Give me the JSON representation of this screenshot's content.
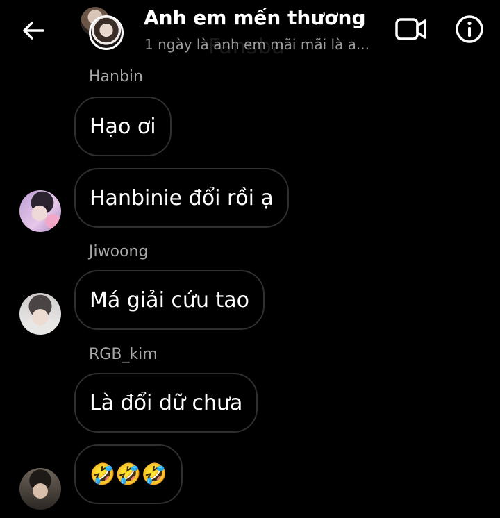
{
  "header": {
    "title": "Anh em mến thương",
    "subtitle": "1 ngày là anh em mãi mãi là a...",
    "watermark": "Fansba",
    "icons": {
      "back": "arrow-left-icon",
      "video": "video-camera-icon",
      "info": "info-icon"
    }
  },
  "messages": [
    {
      "sender": "Hanbin",
      "text": "Hạo ơi"
    },
    {
      "sender": "",
      "text": "Hanbinie đổi rồi ạ"
    },
    {
      "sender": "Jiwoong",
      "text": "Má giải cứu tao"
    },
    {
      "sender": "RGB_kim",
      "text": "Là đổi dữ chưa"
    },
    {
      "sender": "",
      "text": "🤣🤣🤣"
    }
  ],
  "colors": {
    "background": "#000000",
    "bubble_border": "#2f2f2f",
    "sender_name": "#a8a8a8",
    "text": "#ffffff",
    "subtitle": "#9a9a9a"
  }
}
